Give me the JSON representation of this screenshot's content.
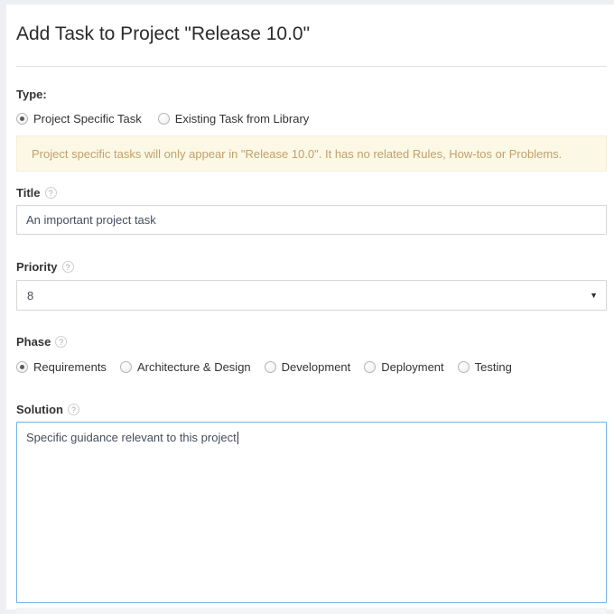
{
  "page": {
    "title": "Add Task to Project \"Release 10.0\""
  },
  "type_section": {
    "label": "Type:",
    "options": [
      {
        "label": "Project Specific Task",
        "selected": true
      },
      {
        "label": "Existing Task from Library",
        "selected": false
      }
    ]
  },
  "alert": {
    "text": "Project specific tasks will only appear in \"Release 10.0\". It has no related Rules, How-tos or Problems.",
    "background_color": "#fcf8e6",
    "text_color": "#c0a16b"
  },
  "title_field": {
    "label": "Title",
    "help_icon": "question-mark-icon",
    "value": "An important project task",
    "placeholder": ""
  },
  "priority_field": {
    "label": "Priority",
    "help_icon": "question-mark-icon",
    "value": "8",
    "arrow": "▼"
  },
  "phase_field": {
    "label": "Phase",
    "help_icon": "question-mark-icon",
    "options": [
      {
        "label": "Requirements",
        "selected": true
      },
      {
        "label": "Architecture & Design",
        "selected": false
      },
      {
        "label": "Development",
        "selected": false
      },
      {
        "label": "Deployment",
        "selected": false
      },
      {
        "label": "Testing",
        "selected": false
      }
    ]
  },
  "solution_field": {
    "label": "Solution",
    "help_icon": "question-mark-icon",
    "value": "Specific guidance relevant to this project",
    "focused": true,
    "focus_border_color": "#72b0e6"
  },
  "help_glyph": "?"
}
